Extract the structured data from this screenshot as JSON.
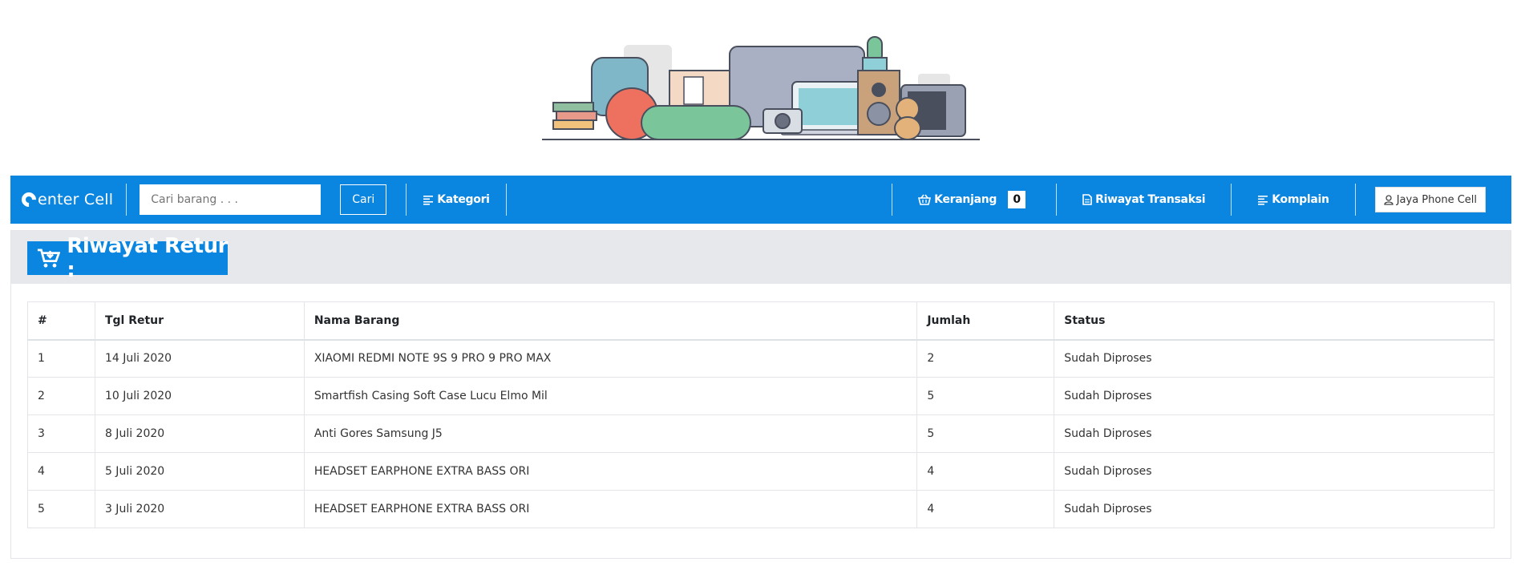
{
  "brand": {
    "name": "enter Cell"
  },
  "search": {
    "placeholder": "Cari barang . . .",
    "value": "",
    "button_label": "Cari"
  },
  "nav": {
    "kategori": "Kategori",
    "keranjang": "Keranjang",
    "cart_count": "0",
    "riwayat_transaksi": "Riwayat Transaksi",
    "komplain": "Komplain",
    "user": "Jaya Phone Cell"
  },
  "page": {
    "title": "Riwayat Retur :"
  },
  "table": {
    "headers": [
      "#",
      "Tgl Retur",
      "Nama Barang",
      "Jumlah",
      "Status"
    ],
    "rows": [
      [
        "1",
        "14 Juli 2020",
        "XIAOMI REDMI NOTE 9S 9 PRO 9 PRO MAX",
        "2",
        "Sudah Diproses"
      ],
      [
        "2",
        "10 Juli 2020",
        "Smartfish Casing Soft Case Lucu Elmo Mil",
        "5",
        "Sudah Diproses"
      ],
      [
        "3",
        "8 Juli 2020",
        "Anti Gores Samsung J5",
        "5",
        "Sudah Diproses"
      ],
      [
        "4",
        "5 Juli 2020",
        "HEADSET EARPHONE EXTRA BASS ORI",
        "4",
        "Sudah Diproses"
      ],
      [
        "5",
        "3 Juli 2020",
        "HEADSET EARPHONE EXTRA BASS ORI",
        "4",
        "Sudah Diproses"
      ]
    ]
  },
  "colors": {
    "primary": "#0b86e0",
    "title_bar_bg": "#e6e8ec"
  },
  "icons": [
    "store-illustration",
    "brand-logo-icon",
    "list-icon",
    "basket-icon",
    "document-icon",
    "user-icon",
    "cart-download-icon"
  ]
}
